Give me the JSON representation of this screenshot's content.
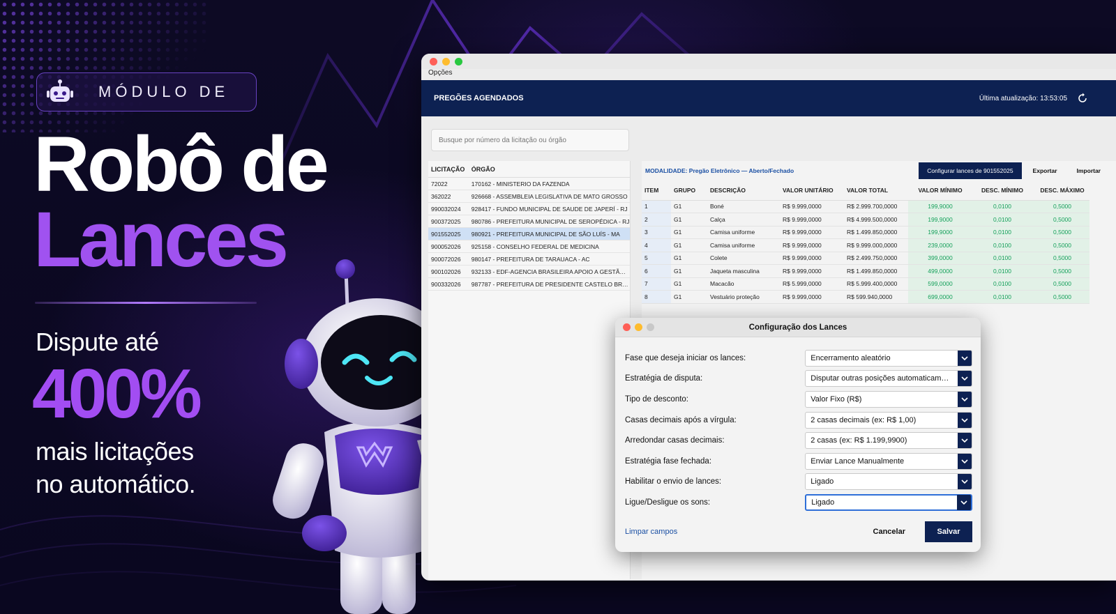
{
  "promo": {
    "badge_text": "MÓDULO DE",
    "headline_line1": "Robô de",
    "headline_line2": "Lances",
    "sub_line1": "Dispute até",
    "big_value": "400%",
    "sub_line2": "mais licitações",
    "sub_line3": "no automático.",
    "accent_color": "#a052f0"
  },
  "window": {
    "menu_label": "Opções",
    "header_title": "PREGÕES AGENDADOS",
    "last_update": "Última atualização: 13:53:05",
    "search_placeholder": "Busque por número da licitação ou órgão"
  },
  "licitacoes": {
    "headers": [
      "LICITAÇÃO",
      "ÓRGÃO"
    ],
    "rows": [
      {
        "lic": "72022",
        "org": "170162 - MINISTERIO DA FAZENDA"
      },
      {
        "lic": "362022",
        "org": "926668 - ASSEMBLEIA LEGISLATIVA DE MATO GROSSO"
      },
      {
        "lic": "990032024",
        "org": "928417 - FUNDO MUNICIPAL DE SAUDE DE JAPERÍ - RJ"
      },
      {
        "lic": "900372025",
        "org": "980786 - PREFEITURA MUNICIPAL DE SEROPÉDICA - RJ"
      },
      {
        "lic": "901552025",
        "org": "980921 - PREFEITURA MUNICIPAL DE SÃO LUÍS - MA",
        "selected": true
      },
      {
        "lic": "900052026",
        "org": "925158 - CONSELHO FEDERAL DE MEDICINA"
      },
      {
        "lic": "900072026",
        "org": "980147 - PREFEITURA DE TARAUACA - AC"
      },
      {
        "lic": "900102026",
        "org": "932133 - EDF-AGENCIA BRASILEIRA APOIO A GESTÃO D..."
      },
      {
        "lic": "900332026",
        "org": "987787 - PREFEITURA DE PRESIDENTE CASTELO BRANC..."
      }
    ]
  },
  "items_panel": {
    "modalidade": "MODALIDADE: Pregão Eletrônico — Aberto/Fechado",
    "config_button": "Configurar lances de 901552025",
    "export_button": "Exportar",
    "import_button": "Importar",
    "headers": [
      "ITEM",
      "GRUPO",
      "DESCRIÇÃO",
      "VALOR UNITÁRIO",
      "VALOR TOTAL",
      "VALOR MÍNIMO",
      "DESC. MÍNIMO",
      "DESC. MÁXIMO"
    ],
    "rows": [
      [
        "1",
        "G1",
        "Boné",
        "R$ 9.999,0000",
        "R$ 2.999.700,0000",
        "199,9000",
        "0,0100",
        "0,5000"
      ],
      [
        "2",
        "G1",
        "Calça",
        "R$ 9.999,0000",
        "R$ 4.999.500,0000",
        "199,9000",
        "0,0100",
        "0,5000"
      ],
      [
        "3",
        "G1",
        "Camisa uniforme",
        "R$ 9.999,0000",
        "R$ 1.499.850,0000",
        "199,9000",
        "0,0100",
        "0,5000"
      ],
      [
        "4",
        "G1",
        "Camisa uniforme",
        "R$ 9.999,0000",
        "R$ 9.999.000,0000",
        "239,0000",
        "0,0100",
        "0,5000"
      ],
      [
        "5",
        "G1",
        "Colete",
        "R$ 9.999,0000",
        "R$ 2.499.750,0000",
        "399,0000",
        "0,0100",
        "0,5000"
      ],
      [
        "6",
        "G1",
        "Jaqueta masculina",
        "R$ 9.999,0000",
        "R$ 1.499.850,0000",
        "499,0000",
        "0,0100",
        "0,5000"
      ],
      [
        "7",
        "G1",
        "Macacão",
        "R$ 5.999,0000",
        "R$ 5.999.400,0000",
        "599,0000",
        "0,0100",
        "0,5000"
      ],
      [
        "8",
        "G1",
        "Vestuário proteção",
        "R$ 9.999,0000",
        "R$ 599.940,0000",
        "699,0000",
        "0,0100",
        "0,5000"
      ]
    ]
  },
  "modal": {
    "title": "Configuração dos Lances",
    "fields": [
      {
        "label": "Fase que deseja iniciar os lances:",
        "value": "Encerramento aleatório"
      },
      {
        "label": "Estratégia de disputa:",
        "value": "Disputar outras posições automaticament..."
      },
      {
        "label": "Tipo de desconto:",
        "value": "Valor Fixo (R$)"
      },
      {
        "label": "Casas decimais após a vírgula:",
        "value": "2 casas decimais (ex: R$ 1,00)"
      },
      {
        "label": "Arredondar casas decimais:",
        "value": "2 casas (ex: R$ 1.199,9900)"
      },
      {
        "label": "Estratégia fase fechada:",
        "value": "Enviar Lance Manualmente"
      },
      {
        "label": "Habilitar o envio de lances:",
        "value": "Ligado"
      },
      {
        "label": "Ligue/Desligue os sons:",
        "value": "Ligado"
      }
    ],
    "clear_link": "Limpar campos",
    "cancel_button": "Cancelar",
    "save_button": "Salvar"
  }
}
